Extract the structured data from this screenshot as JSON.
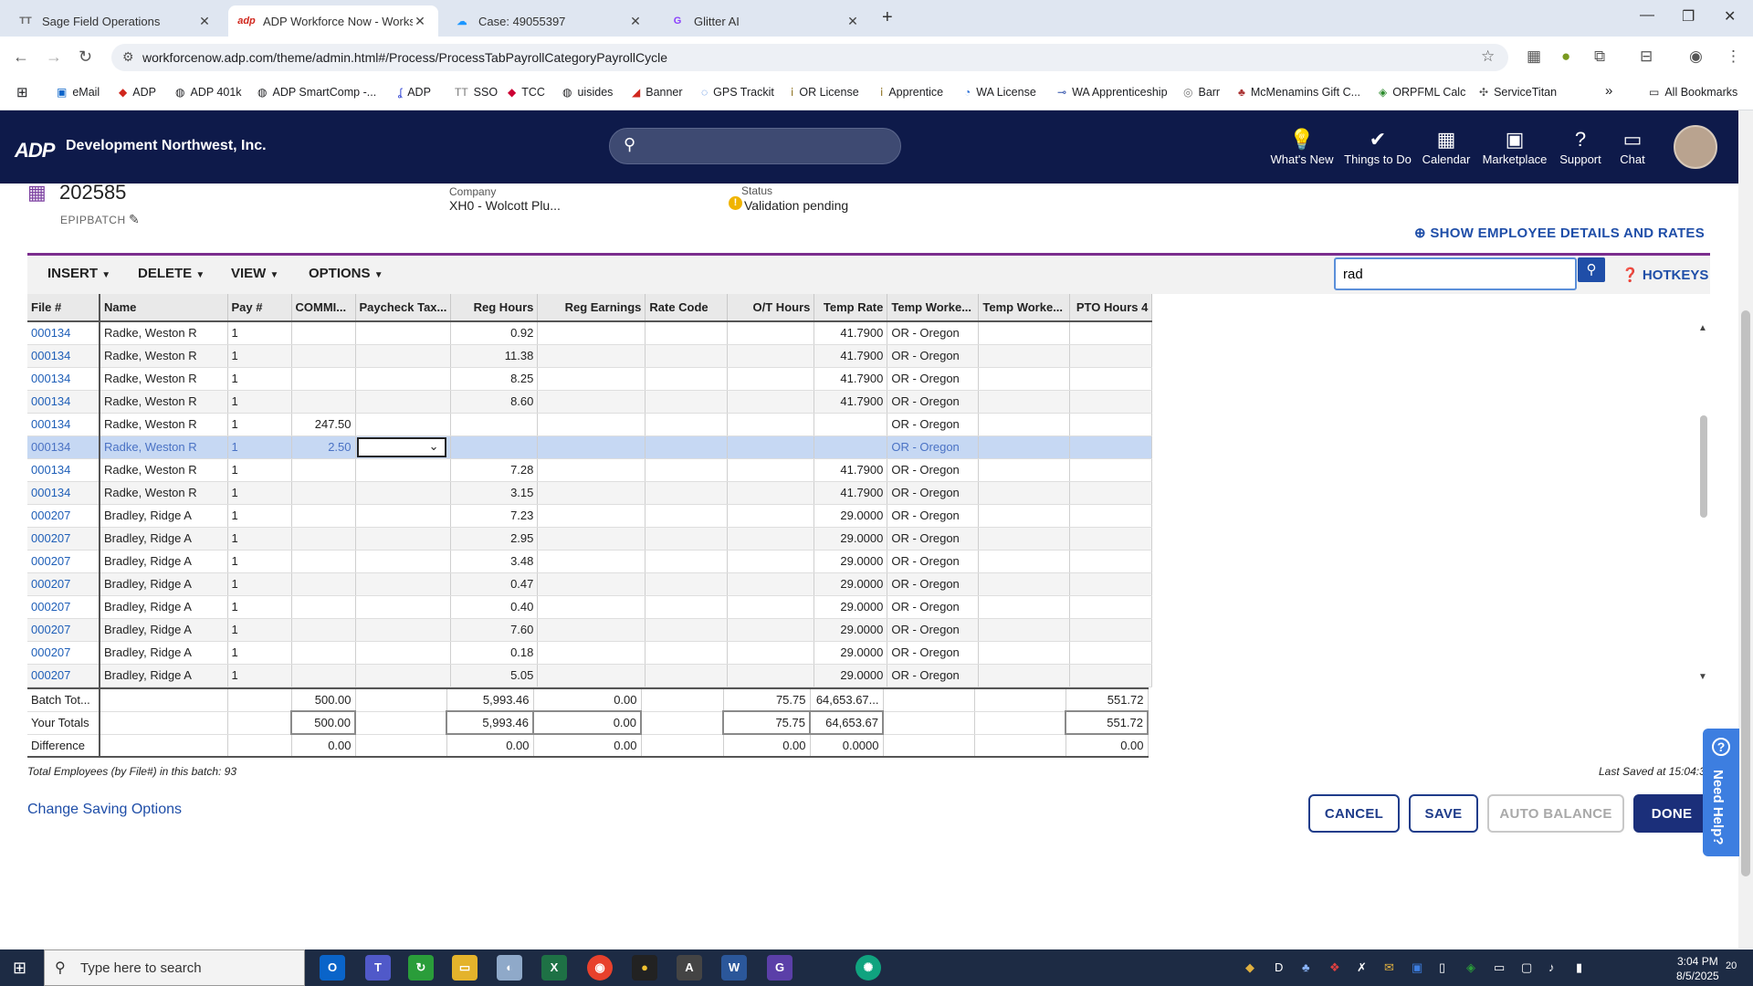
{
  "browser": {
    "tabs": [
      {
        "title": "Sage Field Operations",
        "fav": "TT",
        "fav_color": "#6a6a6a"
      },
      {
        "title": "ADP Workforce Now - Workshe",
        "fav": "adp",
        "fav_color": "#d0271d"
      },
      {
        "title": "Case: 49055397",
        "fav": "☁",
        "fav_color": "#1b96ff"
      },
      {
        "title": "Glitter AI",
        "fav": "G",
        "fav_color": "#8a3ffc"
      }
    ],
    "url": "workforcenow.adp.com/theme/admin.html#/Process/ProcessTabPayrollCategoryPayrollCycle",
    "bookmarks": [
      "eMail",
      "ADP",
      "ADP 401k",
      "ADP SmartComp -...",
      "ADP",
      "SSO",
      "TCC",
      "uisides",
      "Banner",
      "GPS Trackit",
      "OR License",
      "Apprentice",
      "WA License",
      "WA Apprenticeship",
      "Barr",
      "McMenamins Gift C...",
      "ORPFML Calc",
      "ServiceTitan"
    ],
    "all_bookmarks": "All Bookmarks"
  },
  "header": {
    "logo": "ADP",
    "company": "Development Northwest, Inc.",
    "nav": [
      "What's New",
      "Things to Do",
      "Calendar",
      "Marketplace",
      "Support",
      "Chat"
    ]
  },
  "batch": {
    "id": "202585",
    "name": "EPIPBATCH",
    "company_label": "Company",
    "company_value": "XH0 - Wolcott Plu...",
    "status_label": "Status",
    "status_value": "Validation pending",
    "show_details": "SHOW EMPLOYEE DETAILS AND RATES"
  },
  "toolbar": {
    "menus": [
      "INSERT",
      "DELETE",
      "VIEW",
      "OPTIONS"
    ],
    "search_value": "rad",
    "hotkeys": "HOTKEYS"
  },
  "grid": {
    "headers": [
      "File #",
      "Name",
      "Pay #",
      "COMMI...",
      "Paycheck Tax...",
      "Reg Hours",
      "Reg Earnings",
      "Rate Code",
      "O/T Hours",
      "Temp Rate",
      "Temp Worke...",
      "Temp Worke...",
      "PTO Hours 4"
    ],
    "rows": [
      [
        "000134",
        "Radke, Weston R",
        "1",
        "",
        "",
        "0.92",
        "",
        "",
        "",
        "41.7900",
        "OR - Oregon",
        "",
        ""
      ],
      [
        "000134",
        "Radke, Weston R",
        "1",
        "",
        "",
        "11.38",
        "",
        "",
        "",
        "41.7900",
        "OR - Oregon",
        "",
        ""
      ],
      [
        "000134",
        "Radke, Weston R",
        "1",
        "",
        "",
        "8.25",
        "",
        "",
        "",
        "41.7900",
        "OR - Oregon",
        "",
        ""
      ],
      [
        "000134",
        "Radke, Weston R",
        "1",
        "",
        "",
        "8.60",
        "",
        "",
        "",
        "41.7900",
        "OR - Oregon",
        "",
        ""
      ],
      [
        "000134",
        "Radke, Weston R",
        "1",
        "247.50",
        "",
        "",
        "",
        "",
        "",
        "",
        "OR - Oregon",
        "",
        ""
      ],
      [
        "000134",
        "Radke, Weston R",
        "1",
        "2.50",
        "",
        "",
        "",
        "",
        "",
        "",
        "OR - Oregon",
        "",
        ""
      ],
      [
        "000134",
        "Radke, Weston R",
        "1",
        "",
        "",
        "7.28",
        "",
        "",
        "",
        "41.7900",
        "OR - Oregon",
        "",
        ""
      ],
      [
        "000134",
        "Radke, Weston R",
        "1",
        "",
        "",
        "3.15",
        "",
        "",
        "",
        "41.7900",
        "OR - Oregon",
        "",
        ""
      ],
      [
        "000207",
        "Bradley, Ridge A",
        "1",
        "",
        "",
        "7.23",
        "",
        "",
        "",
        "29.0000",
        "OR - Oregon",
        "",
        ""
      ],
      [
        "000207",
        "Bradley, Ridge A",
        "1",
        "",
        "",
        "2.95",
        "",
        "",
        "",
        "29.0000",
        "OR - Oregon",
        "",
        ""
      ],
      [
        "000207",
        "Bradley, Ridge A",
        "1",
        "",
        "",
        "3.48",
        "",
        "",
        "",
        "29.0000",
        "OR - Oregon",
        "",
        ""
      ],
      [
        "000207",
        "Bradley, Ridge A",
        "1",
        "",
        "",
        "0.47",
        "",
        "",
        "",
        "29.0000",
        "OR - Oregon",
        "",
        ""
      ],
      [
        "000207",
        "Bradley, Ridge A",
        "1",
        "",
        "",
        "0.40",
        "",
        "",
        "",
        "29.0000",
        "OR - Oregon",
        "",
        ""
      ],
      [
        "000207",
        "Bradley, Ridge A",
        "1",
        "",
        "",
        "7.60",
        "",
        "",
        "",
        "29.0000",
        "OR - Oregon",
        "",
        ""
      ],
      [
        "000207",
        "Bradley, Ridge A",
        "1",
        "",
        "",
        "0.18",
        "",
        "",
        "",
        "29.0000",
        "OR - Oregon",
        "",
        ""
      ],
      [
        "000207",
        "Bradley, Ridge A",
        "1",
        "",
        "",
        "5.05",
        "",
        "",
        "",
        "29.0000",
        "OR - Oregon",
        "",
        ""
      ]
    ],
    "selected_row": 5
  },
  "totals": [
    [
      "Batch Tot...",
      "",
      "",
      "500.00",
      "",
      "5,993.46",
      "0.00",
      "",
      "75.75",
      "64,653.67...",
      "",
      "",
      "551.72"
    ],
    [
      "Your Totals",
      "",
      "",
      "500.00",
      "",
      "5,993.46",
      "0.00",
      "",
      "75.75",
      "64,653.67",
      "",
      "",
      "551.72"
    ],
    [
      "Difference",
      "",
      "",
      "0.00",
      "",
      "0.00",
      "0.00",
      "",
      "0.00",
      "0.0000",
      "",
      "",
      "0.00"
    ]
  ],
  "footer": {
    "total_employees": "Total Employees (by File#) in this batch: 93",
    "last_saved": "Last Saved at 15:04:3",
    "change_saving": "Change Saving Options",
    "cancel": "CANCEL",
    "save": "SAVE",
    "auto_balance": "AUTO BALANCE",
    "done": "DONE",
    "need_help": "Need Help?"
  },
  "taskbar": {
    "search_placeholder": "Type here to search",
    "time": "3:04 PM",
    "date": "8/5/2025",
    "notif": "20"
  }
}
